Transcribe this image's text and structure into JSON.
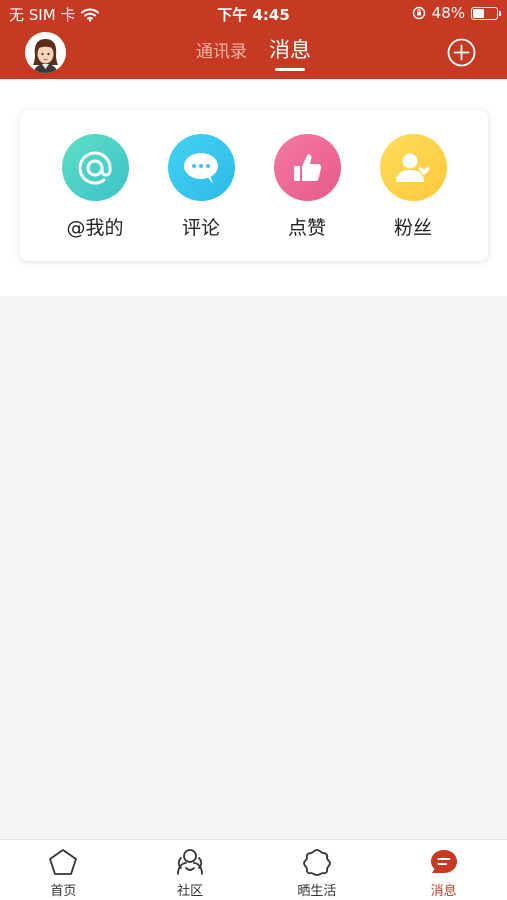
{
  "status_bar": {
    "carrier": "无 SIM 卡",
    "time": "下午 4:45",
    "battery": "48%",
    "battery_level": 0.48
  },
  "header": {
    "tabs": [
      {
        "label": "通讯录",
        "active": false
      },
      {
        "label": "消息",
        "active": true
      }
    ]
  },
  "card": {
    "items": [
      {
        "label": "@我的",
        "icon": "at-icon",
        "color": "#4fd0b8"
      },
      {
        "label": "评论",
        "icon": "comment-icon",
        "color": "#3cc6ec"
      },
      {
        "label": "点赞",
        "icon": "thumbs-up-icon",
        "color": "#ef6a96"
      },
      {
        "label": "粉丝",
        "icon": "fans-icon",
        "color": "#ffd24d"
      }
    ]
  },
  "tabbar": {
    "items": [
      {
        "label": "首页",
        "icon": "pentagon-home-icon",
        "active": false
      },
      {
        "label": "社区",
        "icon": "community-icon",
        "active": false
      },
      {
        "label": "晒生活",
        "icon": "flower-life-icon",
        "active": false
      },
      {
        "label": "消息",
        "icon": "message-icon",
        "active": true
      }
    ]
  },
  "colors": {
    "brand": "#c63a23"
  }
}
